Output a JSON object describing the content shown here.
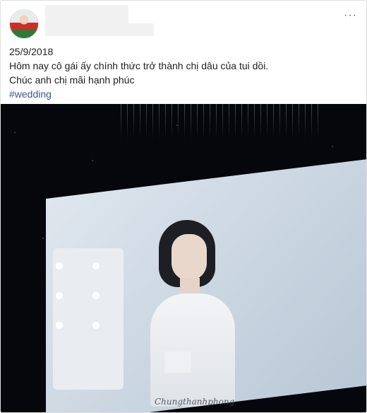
{
  "post": {
    "more_label": "···",
    "date": "25/9/2018",
    "line1": "Hôm nay cô gái ấy chính thức trở thành chị dâu của tui dồi.",
    "line2": "Chúc anh chị mãi hạnh phúc",
    "hashtag": "#wedding"
  },
  "photo": {
    "signature_text": "Chungthanhphong"
  }
}
